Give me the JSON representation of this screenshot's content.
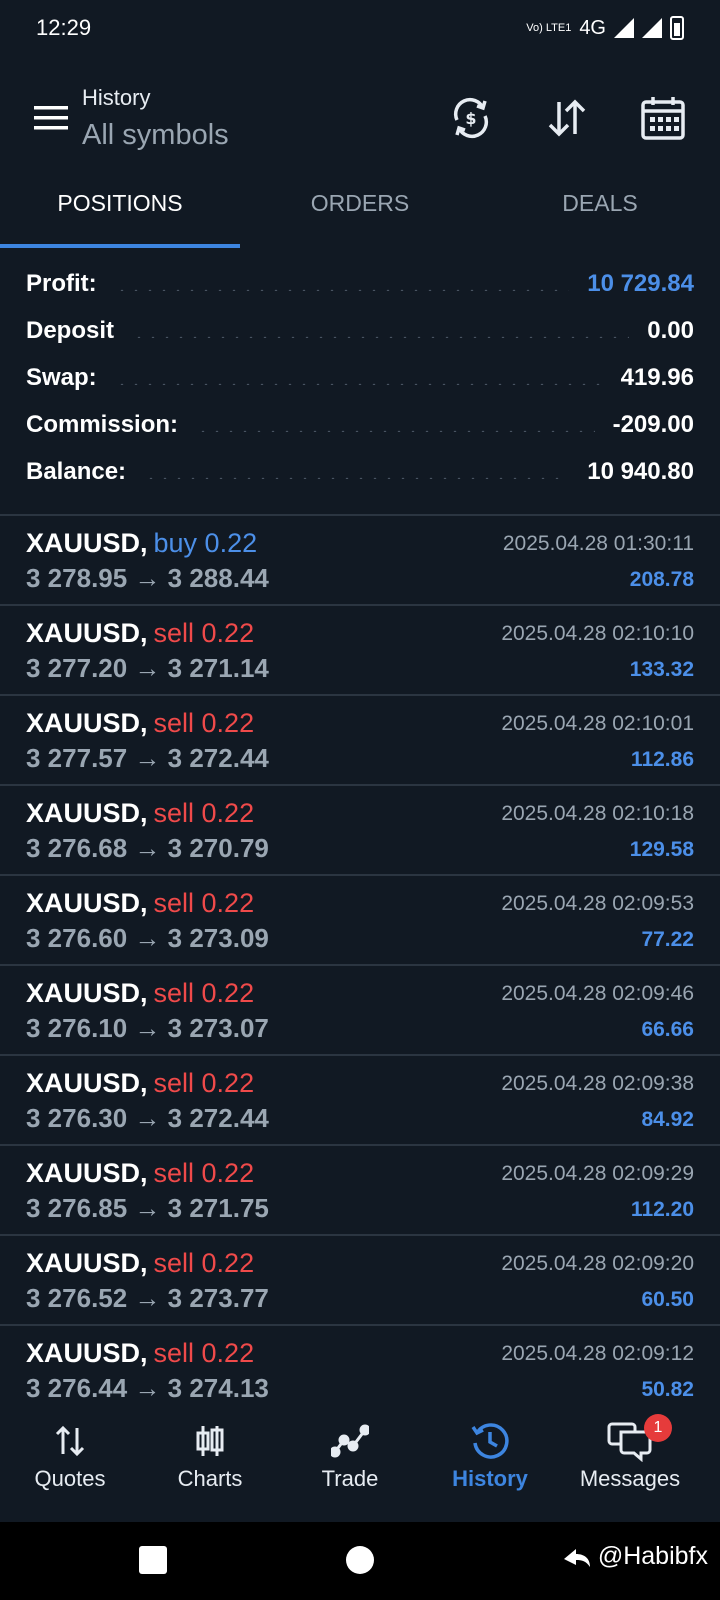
{
  "status_bar": {
    "time": "12:29",
    "volte": "Vo) LTE1",
    "network": "4G"
  },
  "header": {
    "title": "History",
    "subtitle": "All symbols",
    "icons": [
      "menu-icon",
      "currency-exchange-icon",
      "sort-icon",
      "calendar-icon"
    ]
  },
  "tabs": [
    {
      "label": "POSITIONS",
      "active": true
    },
    {
      "label": "ORDERS",
      "active": false
    },
    {
      "label": "DEALS",
      "active": false
    }
  ],
  "summary": [
    {
      "label": "Profit:",
      "value": "10 729.84",
      "highlight": true
    },
    {
      "label": "Deposit",
      "value": "0.00",
      "highlight": false
    },
    {
      "label": "Swap:",
      "value": "419.96",
      "highlight": false
    },
    {
      "label": "Commission:",
      "value": "-209.00",
      "highlight": false
    },
    {
      "label": "Balance:",
      "value": "10 940.80",
      "highlight": false
    }
  ],
  "deals": [
    {
      "symbol": "XAUUSD,",
      "side": "buy 0.22",
      "type": "buy",
      "prices": "3 278.95 → 3 288.44",
      "time": "2025.04.28 01:30:11",
      "profit": "208.78"
    },
    {
      "symbol": "XAUUSD,",
      "side": "sell 0.22",
      "type": "sell",
      "prices": "3 277.20 → 3 271.14",
      "time": "2025.04.28 02:10:10",
      "profit": "133.32"
    },
    {
      "symbol": "XAUUSD,",
      "side": "sell 0.22",
      "type": "sell",
      "prices": "3 277.57 → 3 272.44",
      "time": "2025.04.28 02:10:01",
      "profit": "112.86"
    },
    {
      "symbol": "XAUUSD,",
      "side": "sell 0.22",
      "type": "sell",
      "prices": "3 276.68 → 3 270.79",
      "time": "2025.04.28 02:10:18",
      "profit": "129.58"
    },
    {
      "symbol": "XAUUSD,",
      "side": "sell 0.22",
      "type": "sell",
      "prices": "3 276.60 → 3 273.09",
      "time": "2025.04.28 02:09:53",
      "profit": "77.22"
    },
    {
      "symbol": "XAUUSD,",
      "side": "sell 0.22",
      "type": "sell",
      "prices": "3 276.10 → 3 273.07",
      "time": "2025.04.28 02:09:46",
      "profit": "66.66"
    },
    {
      "symbol": "XAUUSD,",
      "side": "sell 0.22",
      "type": "sell",
      "prices": "3 276.30 → 3 272.44",
      "time": "2025.04.28 02:09:38",
      "profit": "84.92"
    },
    {
      "symbol": "XAUUSD,",
      "side": "sell 0.22",
      "type": "sell",
      "prices": "3 276.85 → 3 271.75",
      "time": "2025.04.28 02:09:29",
      "profit": "112.20"
    },
    {
      "symbol": "XAUUSD,",
      "side": "sell 0.22",
      "type": "sell",
      "prices": "3 276.52 → 3 273.77",
      "time": "2025.04.28 02:09:20",
      "profit": "60.50"
    },
    {
      "symbol": "XAUUSD,",
      "side": "sell 0.22",
      "type": "sell",
      "prices": "3 276.44 → 3 274.13",
      "time": "2025.04.28 02:09:12",
      "profit": "50.82"
    }
  ],
  "bottom_nav": [
    {
      "label": "Quotes",
      "icon": "quotes-icon",
      "active": false
    },
    {
      "label": "Charts",
      "icon": "candlestick-icon",
      "active": false
    },
    {
      "label": "Trade",
      "icon": "trade-icon",
      "active": false
    },
    {
      "label": "History",
      "icon": "history-icon",
      "active": true
    },
    {
      "label": "Messages",
      "icon": "messages-icon",
      "active": false,
      "badge": "1"
    }
  ],
  "watermark": "@Habibfx",
  "colors": {
    "background": "#111923",
    "accent": "#3d85e0",
    "profit": "#4c8fe8",
    "sell": "#f04a4a",
    "muted": "#9aa6b2"
  }
}
